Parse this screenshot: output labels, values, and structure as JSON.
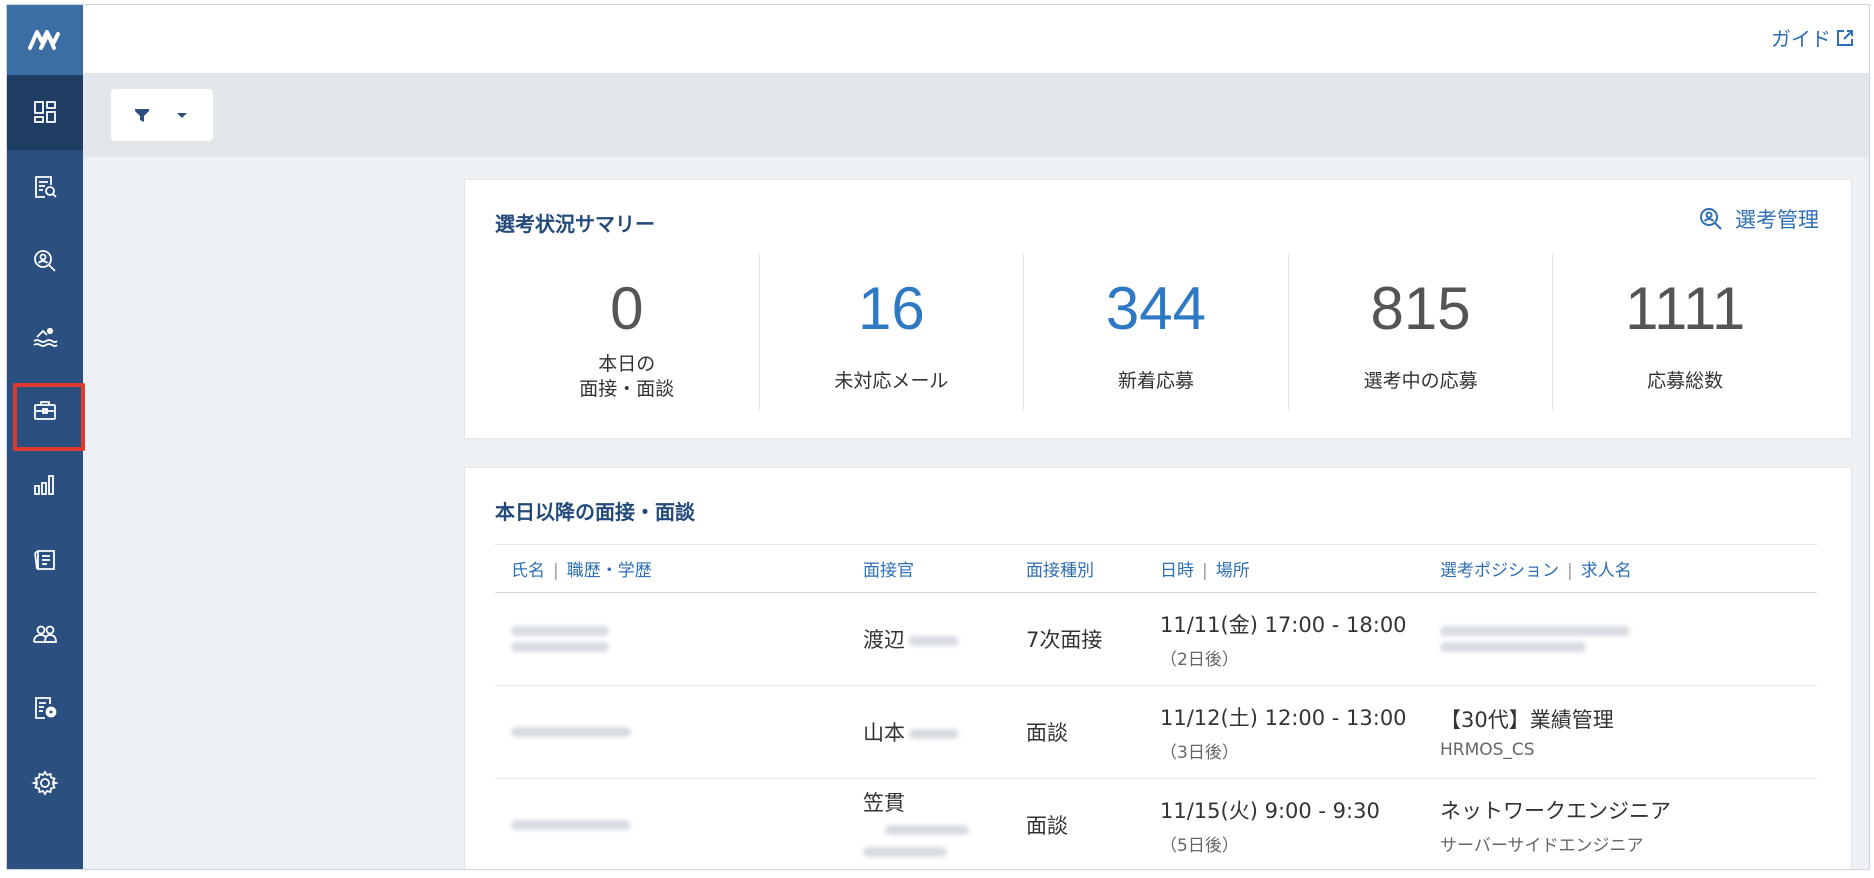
{
  "topbar": {
    "guide_label": "ガイド"
  },
  "summary": {
    "title": "選考状況サマリー",
    "link_label": "選考管理",
    "stats": [
      {
        "value": "0",
        "label": "本日の\n面接・面談"
      },
      {
        "value": "16",
        "label": "未対応メール"
      },
      {
        "value": "344",
        "label": "新着応募"
      },
      {
        "value": "815",
        "label": "選考中の応募"
      },
      {
        "value": "1111",
        "label": "応募総数"
      }
    ]
  },
  "interviews": {
    "title": "本日以降の面接・面談",
    "headers": {
      "name_a": "氏名",
      "name_b": "職歴・学歴",
      "interviewer": "面接官",
      "type": "面接種別",
      "date_a": "日時",
      "date_b": "場所",
      "position_a": "選考ポジション",
      "position_b": "求人名"
    },
    "rows": [
      {
        "interviewer": "渡辺",
        "type": "7次面接",
        "datetime": "11/11(金) 17:00 - 18:00",
        "relative": "（2日後）",
        "position": "",
        "job": ""
      },
      {
        "interviewer": "山本",
        "type": "面談",
        "datetime": "11/12(土) 12:00 - 13:00",
        "relative": "（3日後）",
        "position": "【30代】業績管理",
        "job": "HRMOS_CS"
      },
      {
        "interviewer": "笠貫",
        "type": "面談",
        "datetime": "11/15(火) 9:00 - 9:30",
        "relative": "（5日後）",
        "position": "ネットワークエンジニア",
        "job": "サーバーサイドエンジニア"
      }
    ]
  }
}
